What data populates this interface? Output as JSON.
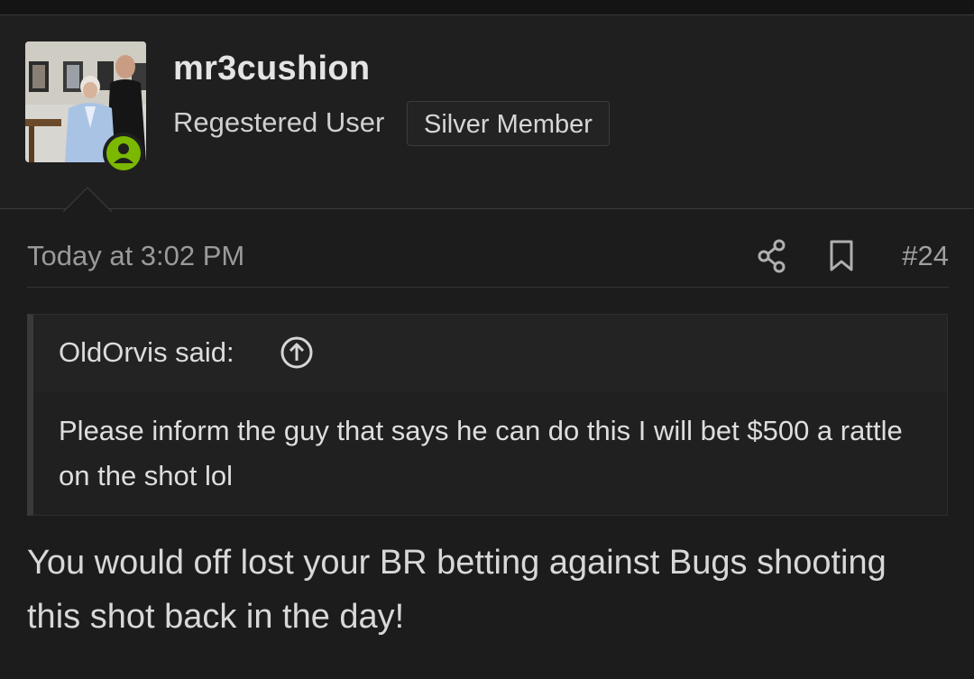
{
  "user": {
    "username": "mr3cushion",
    "title": "Regestered User",
    "badge": "Silver Member",
    "avatar_icon": "user-photo-avatar",
    "online_color": "#7bb800"
  },
  "post": {
    "date": "Today at 3:02 PM",
    "number": "#24",
    "share_icon": "share-icon",
    "bookmark_icon": "bookmark-icon",
    "body": "You would off lost your BR betting against Bugs shooting this shot back in the day!"
  },
  "quote": {
    "author": "OldOrvis said:",
    "jump_icon": "arrow-up-circle-icon",
    "text": "Please inform the guy that says he can do this I will bet $500 a rattle on the shot lol"
  }
}
